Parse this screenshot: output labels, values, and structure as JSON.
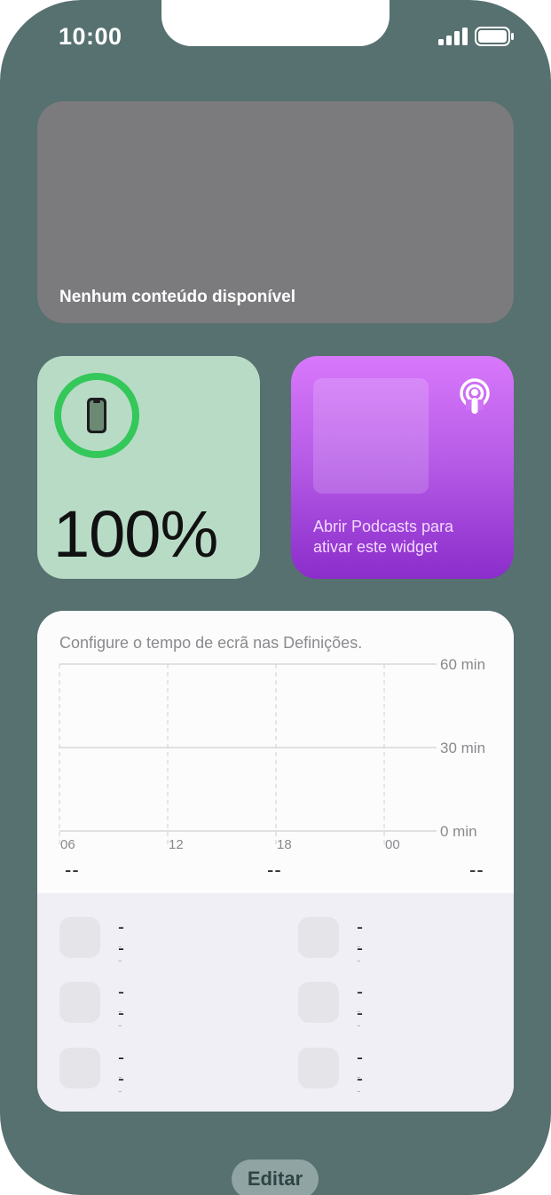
{
  "status_bar": {
    "time": "10:00"
  },
  "widgets": {
    "news": {
      "message": "Nenhum conteúdo disponível"
    },
    "battery": {
      "percent_label": "100%",
      "level": 1.0,
      "ring_color": "#34c759"
    },
    "podcasts": {
      "message": "Abrir Podcasts para ativar este widget"
    },
    "screen_time": {
      "hint": "Configure o tempo de ecrã nas Definições.",
      "y_labels": [
        "60 min",
        "30 min",
        "0 min"
      ],
      "x_labels": [
        "06",
        "12",
        "18",
        "00"
      ],
      "summary": [
        "--",
        "--",
        "--"
      ],
      "apps": [
        {
          "name": "--",
          "time": "--"
        },
        {
          "name": "--",
          "time": "--"
        },
        {
          "name": "--",
          "time": "--"
        },
        {
          "name": "--",
          "time": "--"
        },
        {
          "name": "--",
          "time": "--"
        },
        {
          "name": "--",
          "time": "--"
        }
      ]
    }
  },
  "edit_button": {
    "label": "Editar"
  },
  "colors": {
    "wallpaper": "#577070",
    "battery_widget": "#b8dbc6",
    "podcast_gradient_top": "#d878fb",
    "podcast_gradient_bottom": "#8b2dcb"
  }
}
